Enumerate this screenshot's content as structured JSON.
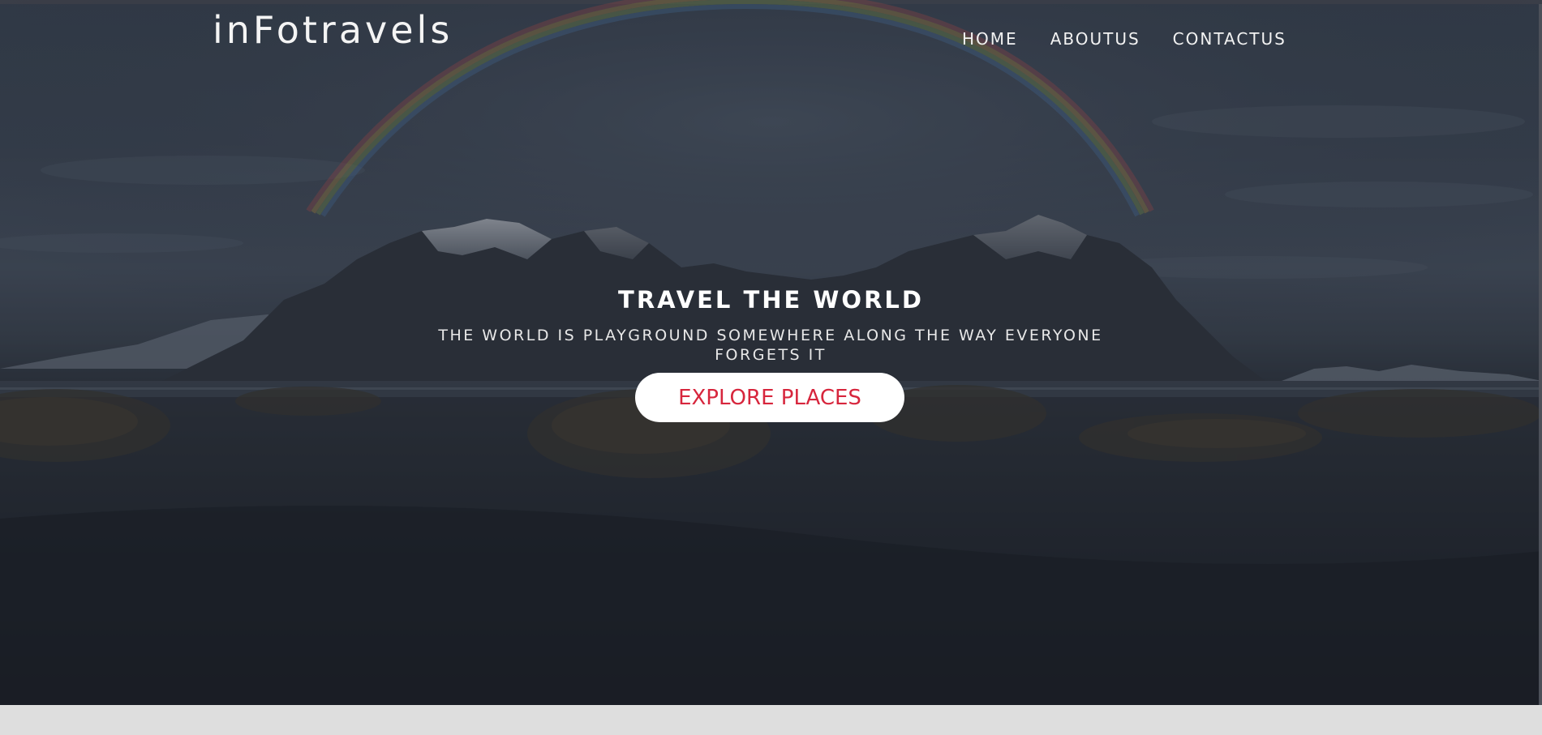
{
  "brand": {
    "logo_text": "inFotravels"
  },
  "nav": {
    "items": [
      {
        "label": "HOME"
      },
      {
        "label": "ABOUTUS"
      },
      {
        "label": "CONTACTUS"
      }
    ]
  },
  "hero": {
    "title": "TRAVEL THE WORLD",
    "subtitle": "THE WORLD IS PLAYGROUND SOMEWHERE ALONG THE WAY EVERYONE FORGETS IT",
    "cta_label": "EXPLORE PLACES",
    "background_image": "dark mountain landscape with rainbow",
    "overlay_color": "#1f2530"
  },
  "colors": {
    "cta_text": "#d7263d",
    "cta_background": "#ffffff",
    "page_bottom": "#dedede"
  }
}
